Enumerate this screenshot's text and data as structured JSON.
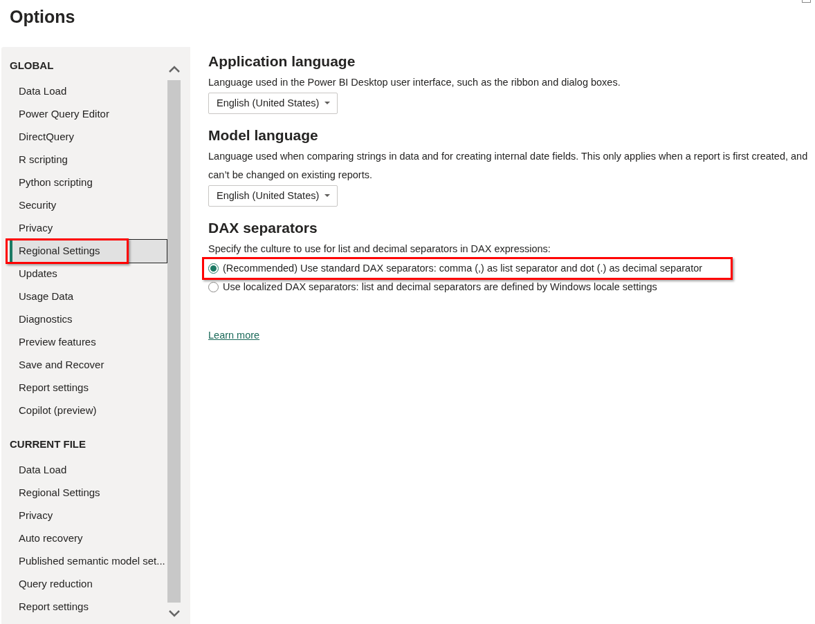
{
  "window": {
    "title": "Options"
  },
  "sidebar": {
    "sections": [
      {
        "heading": "GLOBAL",
        "items": [
          {
            "label": "Data Load",
            "selected": false,
            "highlighted": false
          },
          {
            "label": "Power Query Editor",
            "selected": false,
            "highlighted": false
          },
          {
            "label": "DirectQuery",
            "selected": false,
            "highlighted": false
          },
          {
            "label": "R scripting",
            "selected": false,
            "highlighted": false
          },
          {
            "label": "Python scripting",
            "selected": false,
            "highlighted": false
          },
          {
            "label": "Security",
            "selected": false,
            "highlighted": false
          },
          {
            "label": "Privacy",
            "selected": false,
            "highlighted": false
          },
          {
            "label": "Regional Settings",
            "selected": true,
            "highlighted": true
          },
          {
            "label": "Updates",
            "selected": false,
            "highlighted": false
          },
          {
            "label": "Usage Data",
            "selected": false,
            "highlighted": false
          },
          {
            "label": "Diagnostics",
            "selected": false,
            "highlighted": false
          },
          {
            "label": "Preview features",
            "selected": false,
            "highlighted": false
          },
          {
            "label": "Save and Recover",
            "selected": false,
            "highlighted": false
          },
          {
            "label": "Report settings",
            "selected": false,
            "highlighted": false
          },
          {
            "label": "Copilot (preview)",
            "selected": false,
            "highlighted": false
          }
        ]
      },
      {
        "heading": "CURRENT FILE",
        "items": [
          {
            "label": "Data Load",
            "selected": false,
            "highlighted": false
          },
          {
            "label": "Regional Settings",
            "selected": false,
            "highlighted": false
          },
          {
            "label": "Privacy",
            "selected": false,
            "highlighted": false
          },
          {
            "label": "Auto recovery",
            "selected": false,
            "highlighted": false
          },
          {
            "label": "Published semantic model set...",
            "selected": false,
            "highlighted": false
          },
          {
            "label": "Query reduction",
            "selected": false,
            "highlighted": false
          },
          {
            "label": "Report settings",
            "selected": false,
            "highlighted": false
          }
        ]
      }
    ]
  },
  "sections": [
    {
      "kind": "dropdown",
      "title": "Application language",
      "description": "Language used in the Power BI Desktop user interface, such as the ribbon and dialog boxes.",
      "value": "English (United States)"
    },
    {
      "kind": "dropdown",
      "title": "Model language",
      "description": "Language used when comparing strings in data and for creating internal date fields. This only applies when a report is first created, and can’t be changed on existing reports.",
      "value": "English (United States)"
    },
    {
      "kind": "radios",
      "title": "DAX separators",
      "description": "Specify the culture to use for list and decimal separators in DAX expressions:",
      "options": [
        {
          "label": "(Recommended) Use standard DAX separators: comma (,) as list separator and dot (.) as decimal separator",
          "selected": true,
          "highlighted": true
        },
        {
          "label": "Use localized DAX separators: list and decimal separators are defined by Windows locale settings",
          "selected": false,
          "highlighted": false
        }
      ]
    }
  ],
  "link": "Learn more"
}
